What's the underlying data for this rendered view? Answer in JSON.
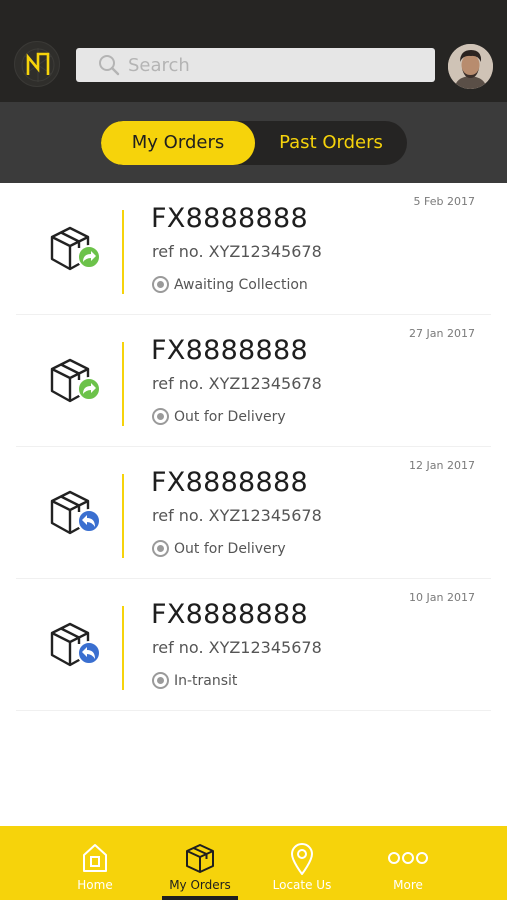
{
  "header": {
    "logo_icon": "brand-logo-icon",
    "search": {
      "placeholder": "Search",
      "value": "",
      "icon": "search-icon"
    },
    "avatar_icon": "user-avatar"
  },
  "tabs": [
    {
      "label": "My Orders",
      "active": true
    },
    {
      "label": "Past Orders",
      "active": false
    }
  ],
  "orders": [
    {
      "date": "5 Feb 2017",
      "tracking": "FX8888888",
      "ref": "ref no. XYZ12345678",
      "status": "Awaiting Collection",
      "badge": "outgoing-arrow",
      "badge_color": "#6cc24a"
    },
    {
      "date": "27 Jan 2017",
      "tracking": "FX8888888",
      "ref": "ref no. XYZ12345678",
      "status": "Out for Delivery",
      "badge": "outgoing-arrow",
      "badge_color": "#6cc24a"
    },
    {
      "date": "12 Jan 2017",
      "tracking": "FX8888888",
      "ref": "ref no. XYZ12345678",
      "status": "Out for Delivery",
      "badge": "return-arrow",
      "badge_color": "#3a6fd0"
    },
    {
      "date": "10 Jan 2017",
      "tracking": "FX8888888",
      "ref": "ref no. XYZ12345678",
      "status": "In-transit",
      "badge": "return-arrow",
      "badge_color": "#3a6fd0"
    }
  ],
  "nav": [
    {
      "label": "Home",
      "icon": "home-icon",
      "active": false
    },
    {
      "label": "My Orders",
      "icon": "box-icon",
      "active": true
    },
    {
      "label": "Locate Us",
      "icon": "location-pin-icon",
      "active": false
    },
    {
      "label": "More",
      "icon": "more-dots-icon",
      "active": false
    }
  ],
  "colors": {
    "accent": "#f6d30b",
    "header_bg": "#262523",
    "tabbar_bg": "#3b3b3b",
    "green_badge": "#6cc24a",
    "blue_badge": "#3a6fd0"
  }
}
